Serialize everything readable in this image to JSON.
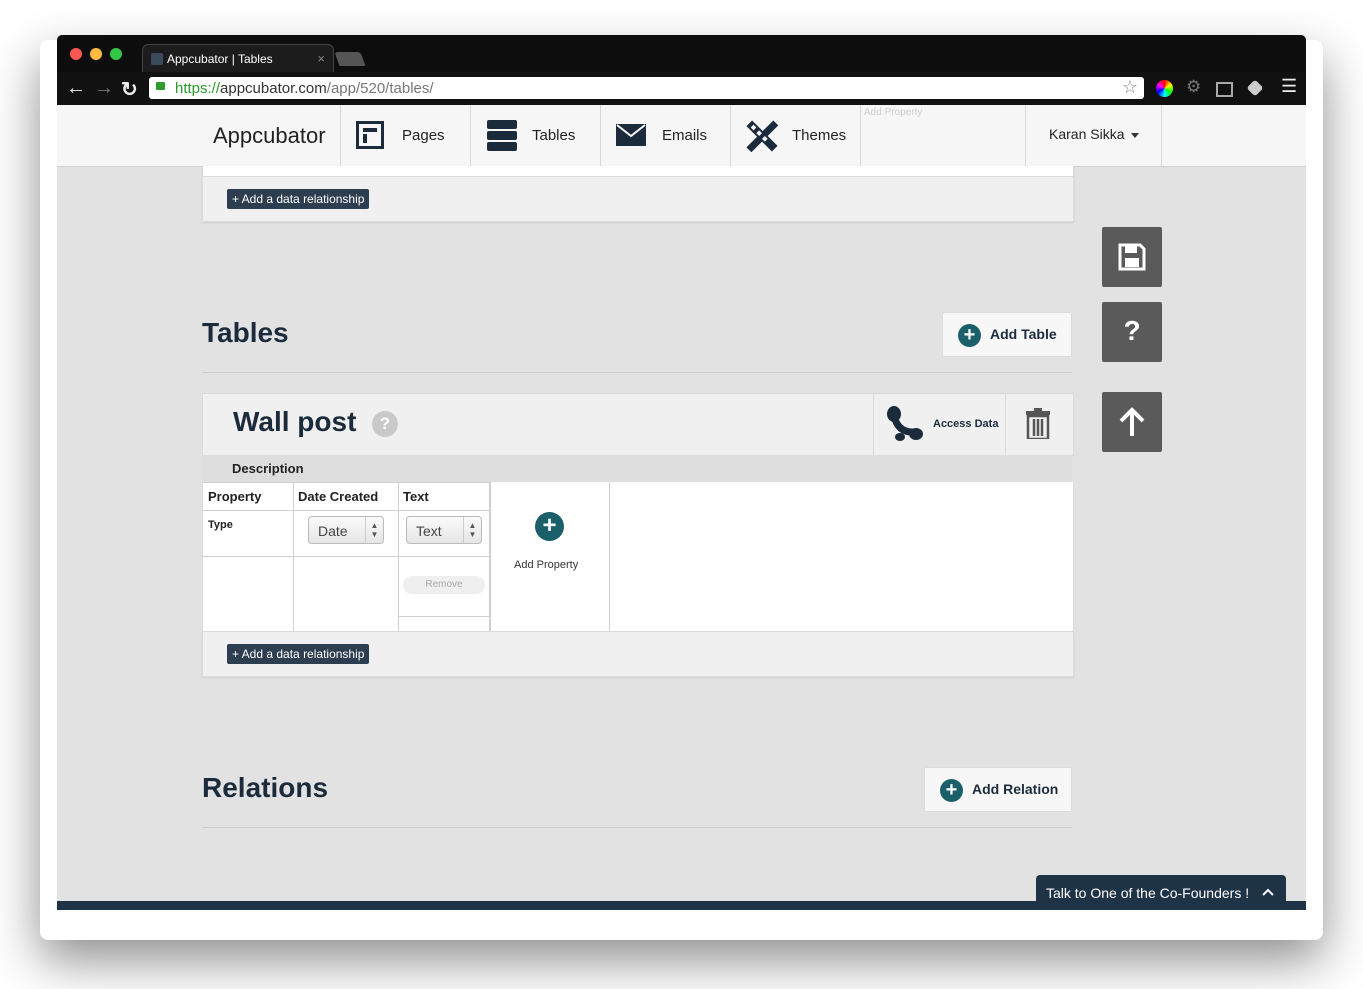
{
  "browser": {
    "tab_title": "Appcubator | Tables",
    "url_scheme": "https://",
    "url_host": "appcubator.com",
    "url_path": "/app/520/tables/"
  },
  "header": {
    "brand": "Appcubator",
    "nav": [
      {
        "label": "Pages"
      },
      {
        "label": "Tables"
      },
      {
        "label": "Emails"
      },
      {
        "label": "Themes"
      }
    ],
    "ghost_text": "Add Property",
    "user_name": "Karan Sikka"
  },
  "top_panel": {
    "add_relationship_label": "+ Add a data relationship"
  },
  "tables_section": {
    "title": "Tables",
    "add_label": "Add Table"
  },
  "sidebar": {
    "help_label": "?"
  },
  "table_card": {
    "name": "Wall post",
    "help_label": "?",
    "access_label": "Access Data",
    "description_label": "Description",
    "columns": [
      "Property",
      "Date Created",
      "Text"
    ],
    "type_label": "Type",
    "types": [
      "Date",
      "Text"
    ],
    "remove_label": "Remove",
    "add_property_label": "Add Property",
    "add_relationship_label": "+ Add a data relationship"
  },
  "relations_section": {
    "title": "Relations",
    "add_label": "Add Relation"
  },
  "chat": {
    "label": "Talk to One of the Co-Founders !"
  },
  "colors": {
    "primary_dark": "#1b2b3c",
    "accent_teal": "#1b5f6b",
    "side_button": "#5a5a5a"
  }
}
